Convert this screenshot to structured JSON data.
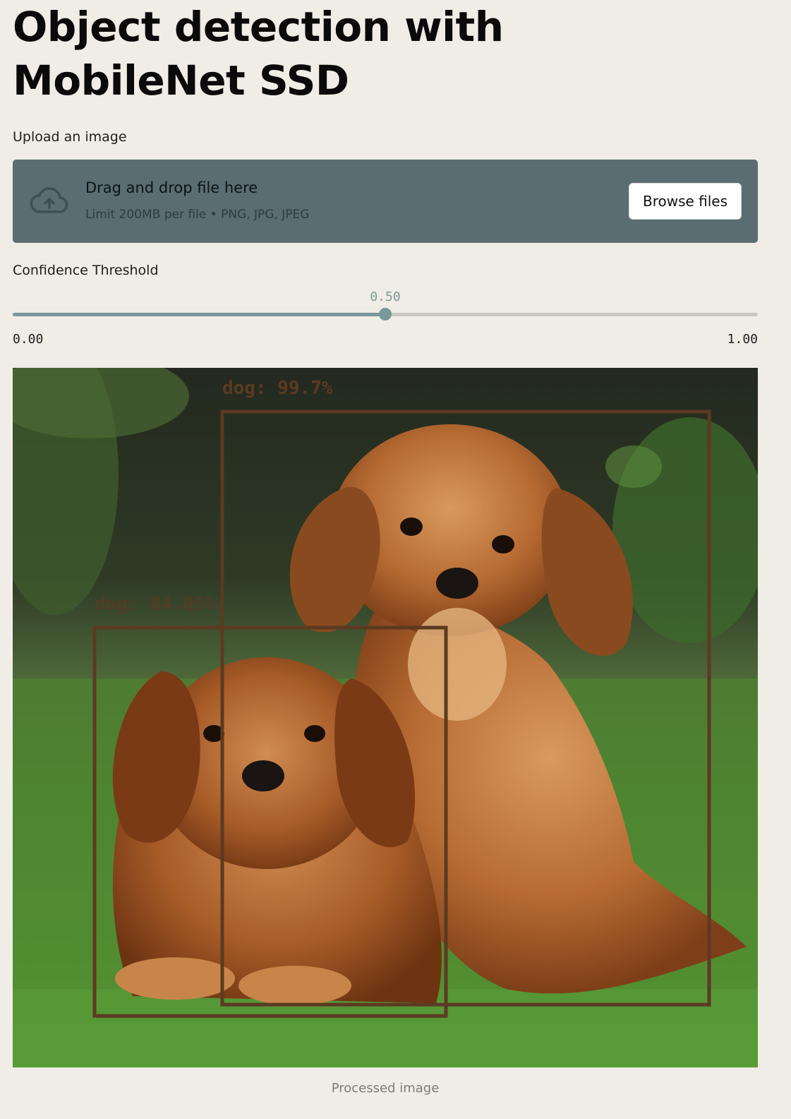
{
  "page": {
    "title": "Object detection with MobileNet SSD"
  },
  "uploader": {
    "label": "Upload an image",
    "icon": "cloud-upload-icon",
    "drop_title": "Drag and drop file here",
    "drop_subtitle": "Limit 200MB per file • PNG, JPG, JPEG",
    "browse_label": "Browse files"
  },
  "slider": {
    "label": "Confidence Threshold",
    "value": 0.5,
    "value_text": "0.50",
    "min_text": "0.00",
    "max_text": "1.00"
  },
  "image": {
    "caption": "Processed image",
    "detections": [
      {
        "label": "dog: 99.7%",
        "color": "#5c3a22"
      },
      {
        "label": "dog: 84.05%",
        "color": "#5c3a22"
      }
    ]
  },
  "colors": {
    "background": "#f0ece6",
    "dropzone": "#5a6d72",
    "slider_accent": "#78989a",
    "box": "#5c3a22"
  }
}
